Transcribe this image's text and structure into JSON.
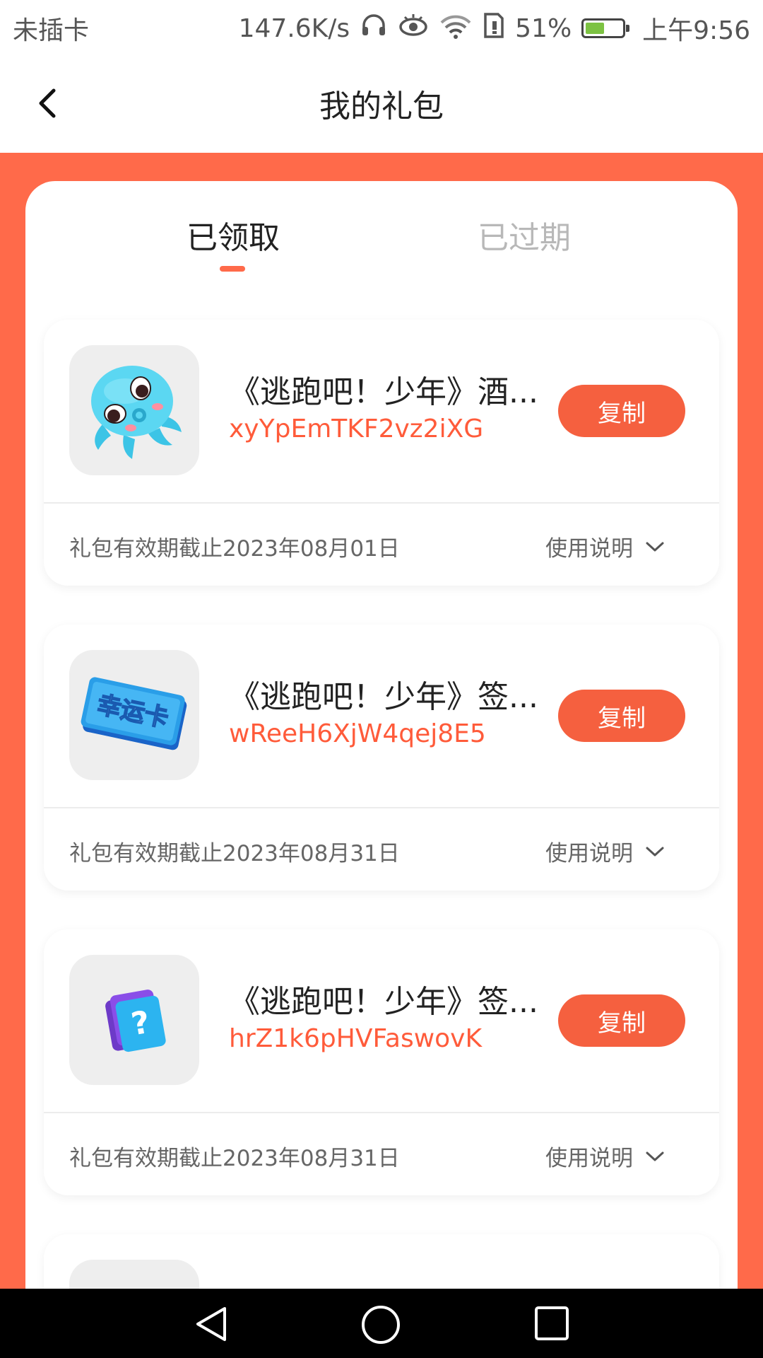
{
  "status_bar": {
    "carrier": "未插卡",
    "net_speed": "147.6K/s",
    "battery_percent": "51%",
    "time": "上午9:56",
    "battery_level": 0.51,
    "icons": [
      "headphones-icon",
      "eye-icon",
      "wifi-icon",
      "sim-icon",
      "battery-icon"
    ]
  },
  "header": {
    "title": "我的礼包",
    "back_icon": "chevron-left-icon"
  },
  "tabs": [
    {
      "label": "已领取",
      "active": true
    },
    {
      "label": "已过期",
      "active": false
    }
  ],
  "gifts": [
    {
      "title": "《逃跑吧！少年》酒...",
      "code": "xyYpEmTKF2vz2iXG",
      "copy_label": "复制",
      "expiry": "礼包有效期截止2023年08月01日",
      "instructions_label": "使用说明",
      "icon": "octopus-icon"
    },
    {
      "title": "《逃跑吧！少年》签...",
      "code": "wReeH6XjW4qej8E5",
      "copy_label": "复制",
      "expiry": "礼包有效期截止2023年08月31日",
      "instructions_label": "使用说明",
      "icon": "lucky-card-icon",
      "icon_text": "幸运卡"
    },
    {
      "title": "《逃跑吧！少年》签...",
      "code": "hrZ1k6pHVFaswovK",
      "copy_label": "复制",
      "expiry": "礼包有效期截止2023年08月31日",
      "instructions_label": "使用说明",
      "icon": "mystery-card-icon",
      "icon_text": "?"
    }
  ],
  "colors": {
    "accent": "#ff6a4a",
    "button": "#f5603f",
    "code_text": "#ff5b3a"
  },
  "nav_bar": [
    "back-triangle-icon",
    "home-circle-icon",
    "recents-square-icon"
  ]
}
